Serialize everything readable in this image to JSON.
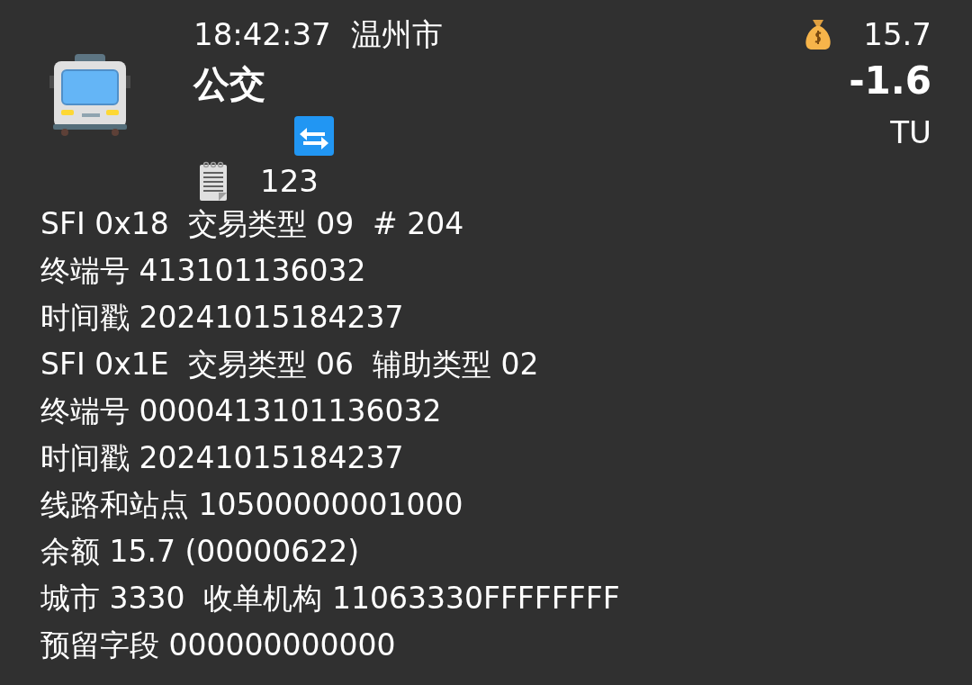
{
  "header": {
    "time": "18:42:37",
    "city": "温州市",
    "title": "公交",
    "record_count": "123",
    "balance": "15.7",
    "amount": "-1.6",
    "type_code": "TU"
  },
  "lines": [
    "SFI 0x18  交易类型 09  # 204",
    "终端号 413101136032",
    "时间戳 20241015184237",
    "SFI 0x1E  交易类型 06  辅助类型 02",
    "终端号 0000413101136032",
    "时间戳 20241015184237",
    "线路和站点 10500000001000",
    "余额 15.7 (00000622)",
    "城市 3330  收单机构 11063330FFFFFFFF",
    "预留字段 000000000000"
  ]
}
